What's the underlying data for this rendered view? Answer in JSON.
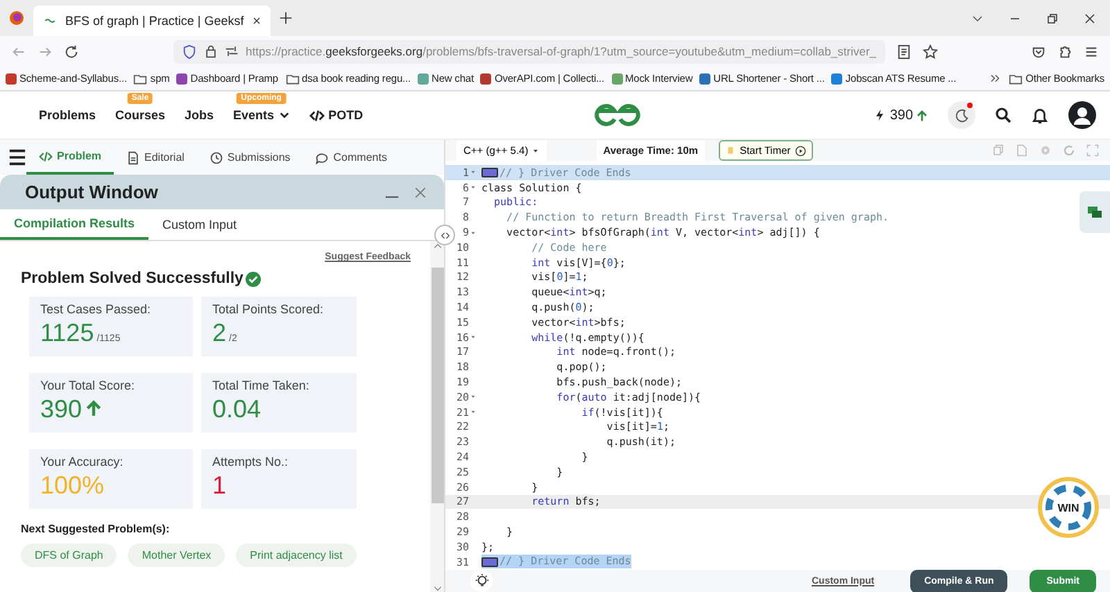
{
  "browser": {
    "tab_title": "BFS of graph | Practice | Geeksf",
    "url": {
      "prefix": "https://practice.",
      "domain": "geeksforgeeks.org",
      "path": "/problems/bfs-traversal-of-graph/1?utm_source=youtube&utm_medium=collab_striver_"
    }
  },
  "bookmarks": [
    {
      "label": "Scheme-and-Syllabus...",
      "kind": "site",
      "color": "#c0392b"
    },
    {
      "label": "spm",
      "kind": "folder"
    },
    {
      "label": "Dashboard | Pramp",
      "kind": "site",
      "color": "#8e44ad"
    },
    {
      "label": "dsa book reading regu...",
      "kind": "folder"
    },
    {
      "label": "New chat",
      "kind": "site",
      "color": "#5fa89a"
    },
    {
      "label": "OverAPI.com | Collecti...",
      "kind": "site",
      "color": "#b03a2e"
    },
    {
      "label": "Mock Interview",
      "kind": "site",
      "color": "#6aa56a"
    },
    {
      "label": "URL Shortener - Short ...",
      "kind": "site",
      "color": "#2c6fb5"
    },
    {
      "label": "Jobscan ATS Resume ...",
      "kind": "site",
      "color": "#1f7fd6"
    }
  ],
  "other_bookmarks": "Other Bookmarks",
  "site_nav": {
    "items": [
      {
        "label": "Problems",
        "dropdown": false
      },
      {
        "label": "Courses",
        "badge": "Sale",
        "dropdown": false
      },
      {
        "label": "Jobs",
        "dropdown": false
      },
      {
        "label": "Events",
        "badge": "Upcoming",
        "dropdown": true
      }
    ],
    "potd": "POTD",
    "streak": "390"
  },
  "problem_tabs": [
    {
      "label": "Problem",
      "kind": "code",
      "selected": true
    },
    {
      "label": "Editorial",
      "kind": "doc",
      "selected": false
    },
    {
      "label": "Submissions",
      "kind": "clock",
      "selected": false
    },
    {
      "label": "Comments",
      "kind": "comment",
      "selected": false
    }
  ],
  "output_window": {
    "title": "Output Window",
    "tabs": [
      {
        "label": "Compilation Results",
        "selected": true
      },
      {
        "label": "Custom Input",
        "selected": false
      }
    ],
    "feedback_link": "Suggest Feedback",
    "status": "Problem Solved Successfully",
    "stats": [
      {
        "label": "Test Cases Passed:",
        "value": "1125",
        "suffix": "/1125",
        "color": "#2f8d46",
        "arrow_up": false
      },
      {
        "label": "Total Points Scored:",
        "value": "2",
        "suffix": "/2",
        "color": "#2f8d46",
        "arrow_up": false
      },
      {
        "label": "Your Total Score:",
        "value": "390",
        "color": "#2f8d46",
        "arrow_up": true
      },
      {
        "label": "Total Time Taken:",
        "value": "0.04",
        "color": "#2f8d46",
        "arrow_up": false
      },
      {
        "label": "Your Accuracy:",
        "value": "100%",
        "color": "#f0b429",
        "arrow_up": false
      },
      {
        "label": "Attempts No.:",
        "value": "1",
        "color": "#d91e36",
        "arrow_up": false
      }
    ],
    "next_heading": "Next Suggested Problem(s):",
    "suggestions": [
      "DFS of Graph",
      "Mother Vertex",
      "Print adjacency list"
    ]
  },
  "editor": {
    "language": "C++ (g++ 5.4)",
    "average_time": "Average Time: 10m",
    "timer_button": "Start Timer",
    "lines": [
      {
        "number": "1",
        "foldable": true,
        "folded": true,
        "selected": true,
        "active": false,
        "tokens": [
          {
            "text": "// } Driver Code Ends",
            "kind": "comment"
          }
        ]
      },
      {
        "number": "6",
        "foldable": true,
        "folded": false,
        "selected": false,
        "active": false,
        "tokens": [
          {
            "text": "class Solution {",
            "kind": "plain"
          }
        ]
      },
      {
        "number": "7",
        "foldable": false,
        "folded": false,
        "selected": false,
        "active": false,
        "tokens": [
          {
            "text": "  public:",
            "kind": "keyword"
          }
        ]
      },
      {
        "number": "8",
        "foldable": false,
        "folded": false,
        "selected": false,
        "active": false,
        "tokens": [
          {
            "text": "    // Function to return Breadth First Traversal of given graph.",
            "kind": "comment"
          }
        ]
      },
      {
        "number": "9",
        "foldable": true,
        "folded": false,
        "selected": false,
        "active": false,
        "tokens": [
          {
            "text": "    vector<",
            "kind": "plain"
          },
          {
            "text": "int",
            "kind": "keyword"
          },
          {
            "text": "> bfsOfGraph(",
            "kind": "plain"
          },
          {
            "text": "int",
            "kind": "keyword"
          },
          {
            "text": " V, vector<",
            "kind": "plain"
          },
          {
            "text": "int",
            "kind": "keyword"
          },
          {
            "text": "> adj[]) {",
            "kind": "plain"
          }
        ]
      },
      {
        "number": "10",
        "foldable": false,
        "folded": false,
        "selected": false,
        "active": false,
        "tokens": [
          {
            "text": "        // Code here",
            "kind": "comment"
          }
        ]
      },
      {
        "number": "11",
        "foldable": false,
        "folded": false,
        "selected": false,
        "active": false,
        "tokens": [
          {
            "text": "        int",
            "kind": "keyword"
          },
          {
            "text": " vis[V]={",
            "kind": "plain"
          },
          {
            "text": "0",
            "kind": "number"
          },
          {
            "text": "};",
            "kind": "plain"
          }
        ]
      },
      {
        "number": "12",
        "foldable": false,
        "folded": false,
        "selected": false,
        "active": false,
        "tokens": [
          {
            "text": "        vis[",
            "kind": "plain"
          },
          {
            "text": "0",
            "kind": "number"
          },
          {
            "text": "]=",
            "kind": "plain"
          },
          {
            "text": "1",
            "kind": "number"
          },
          {
            "text": ";",
            "kind": "plain"
          }
        ]
      },
      {
        "number": "13",
        "foldable": false,
        "folded": false,
        "selected": false,
        "active": false,
        "tokens": [
          {
            "text": "        queue<",
            "kind": "plain"
          },
          {
            "text": "int",
            "kind": "keyword"
          },
          {
            "text": ">q;",
            "kind": "plain"
          }
        ]
      },
      {
        "number": "14",
        "foldable": false,
        "folded": false,
        "selected": false,
        "active": false,
        "tokens": [
          {
            "text": "        q.push(",
            "kind": "plain"
          },
          {
            "text": "0",
            "kind": "number"
          },
          {
            "text": ");",
            "kind": "plain"
          }
        ]
      },
      {
        "number": "15",
        "foldable": false,
        "folded": false,
        "selected": false,
        "active": false,
        "tokens": [
          {
            "text": "        vector<",
            "kind": "plain"
          },
          {
            "text": "int",
            "kind": "keyword"
          },
          {
            "text": ">bfs;",
            "kind": "plain"
          }
        ]
      },
      {
        "number": "16",
        "foldable": true,
        "folded": false,
        "selected": false,
        "active": false,
        "tokens": [
          {
            "text": "        while",
            "kind": "keyword"
          },
          {
            "text": "(!q.empty()){",
            "kind": "plain"
          }
        ]
      },
      {
        "number": "17",
        "foldable": false,
        "folded": false,
        "selected": false,
        "active": false,
        "tokens": [
          {
            "text": "            int",
            "kind": "keyword"
          },
          {
            "text": " node=q.front();",
            "kind": "plain"
          }
        ]
      },
      {
        "number": "18",
        "foldable": false,
        "folded": false,
        "selected": false,
        "active": false,
        "tokens": [
          {
            "text": "            q.pop();",
            "kind": "plain"
          }
        ]
      },
      {
        "number": "19",
        "foldable": false,
        "folded": false,
        "selected": false,
        "active": false,
        "tokens": [
          {
            "text": "            bfs.push_back(node);",
            "kind": "plain"
          }
        ]
      },
      {
        "number": "20",
        "foldable": true,
        "folded": false,
        "selected": false,
        "active": false,
        "tokens": [
          {
            "text": "            for",
            "kind": "keyword"
          },
          {
            "text": "(",
            "kind": "plain"
          },
          {
            "text": "auto",
            "kind": "keyword"
          },
          {
            "text": " it:adj[node]){",
            "kind": "plain"
          }
        ]
      },
      {
        "number": "21",
        "foldable": true,
        "folded": false,
        "selected": false,
        "active": false,
        "tokens": [
          {
            "text": "                if",
            "kind": "keyword"
          },
          {
            "text": "(!vis[it]){",
            "kind": "plain"
          }
        ]
      },
      {
        "number": "22",
        "foldable": false,
        "folded": false,
        "selected": false,
        "active": false,
        "tokens": [
          {
            "text": "                    vis[it]=",
            "kind": "plain"
          },
          {
            "text": "1",
            "kind": "number"
          },
          {
            "text": ";",
            "kind": "plain"
          }
        ]
      },
      {
        "number": "23",
        "foldable": false,
        "folded": false,
        "selected": false,
        "active": false,
        "tokens": [
          {
            "text": "                    q.push(it);",
            "kind": "plain"
          }
        ]
      },
      {
        "number": "24",
        "foldable": false,
        "folded": false,
        "selected": false,
        "active": false,
        "tokens": [
          {
            "text": "                }",
            "kind": "plain"
          }
        ]
      },
      {
        "number": "25",
        "foldable": false,
        "folded": false,
        "selected": false,
        "active": false,
        "tokens": [
          {
            "text": "            }",
            "kind": "plain"
          }
        ]
      },
      {
        "number": "26",
        "foldable": false,
        "folded": false,
        "selected": false,
        "active": false,
        "tokens": [
          {
            "text": "        }",
            "kind": "plain"
          }
        ]
      },
      {
        "number": "27",
        "foldable": false,
        "folded": false,
        "selected": false,
        "active": true,
        "tokens": [
          {
            "text": "        return",
            "kind": "keyword"
          },
          {
            "text": " bfs;",
            "kind": "plain"
          }
        ]
      },
      {
        "number": "28",
        "foldable": false,
        "folded": false,
        "selected": false,
        "active": false
      },
      {
        "number": "29",
        "foldable": false,
        "folded": false,
        "selected": false,
        "active": false,
        "tokens": [
          {
            "text": "    }",
            "kind": "plain"
          }
        ]
      },
      {
        "number": "30",
        "foldable": false,
        "folded": false,
        "selected": false,
        "active": false,
        "tokens": [
          {
            "text": "};",
            "kind": "plain"
          }
        ]
      },
      {
        "number": "31",
        "foldable": false,
        "folded": true,
        "selected": true,
        "active": false,
        "tokens": [
          {
            "text": "// } Driver Code Ends",
            "kind": "comment"
          }
        ]
      }
    ],
    "footer": {
      "custom_input": "Custom Input",
      "compile": "Compile & Run",
      "submit": "Submit"
    }
  },
  "win_badge": "WIN"
}
